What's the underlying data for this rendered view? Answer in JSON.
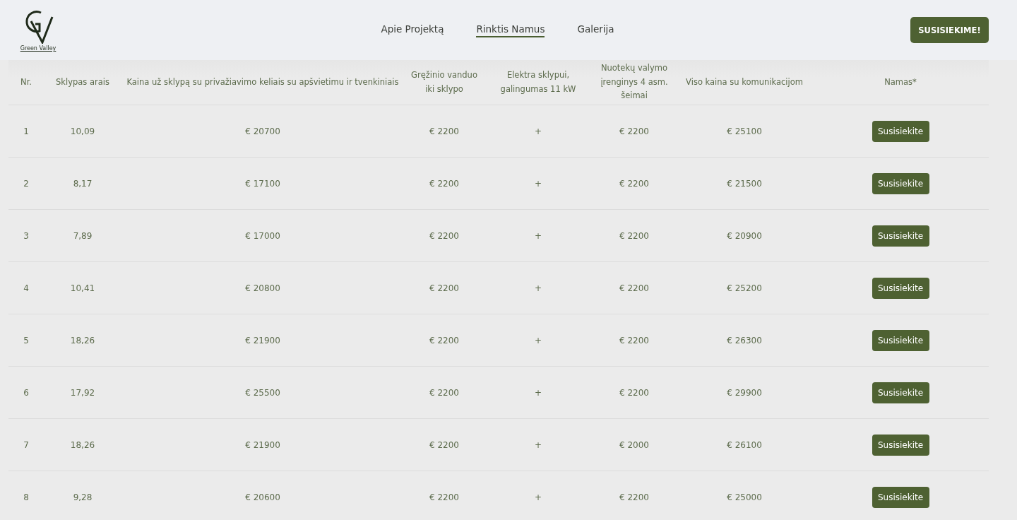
{
  "logo": {
    "name": "Green Valley"
  },
  "nav": [
    {
      "label": "Apie Projektą",
      "selected": false
    },
    {
      "label": "Rinktis Namus",
      "selected": true
    },
    {
      "label": "Galerija",
      "selected": false
    }
  ],
  "cta_button": "SUSISIEKIME!",
  "table": {
    "columns": [
      "Nr.",
      "Sklypas arais",
      "Kaina už sklypą su privažiavimo keliais su apšvietimu ir tvenkiniais",
      "Gręžinio vanduo iki sklypo",
      "Elektra sklypui, galingumas 11 kW",
      "Nuotekų valymo įrenginys 4 asm. šeimai",
      "Viso kaina su komunikacijom",
      "Namas*"
    ],
    "rows": [
      [
        "1",
        "10,09",
        "€ 20700",
        "€ 2200",
        "+",
        "€ 2200",
        "€ 25100",
        "Susisiekite"
      ],
      [
        "2",
        "8,17",
        "€ 17100",
        "€ 2200",
        "+",
        "€ 2200",
        "€ 21500",
        "Susisiekite"
      ],
      [
        "3",
        "7,89",
        "€ 17000",
        "€ 2200",
        "+",
        "€ 2200",
        "€ 20900",
        "Susisiekite"
      ],
      [
        "4",
        "10,41",
        "€ 20800",
        "€ 2200",
        "+",
        "€ 2200",
        "€ 25200",
        "Susisiekite"
      ],
      [
        "5",
        "18,26",
        "€ 21900",
        "€ 2200",
        "+",
        "€ 2200",
        "€ 26300",
        "Susisiekite"
      ],
      [
        "6",
        "17,92",
        "€ 25500",
        "€ 2200",
        "+",
        "€ 2200",
        "€ 29900",
        "Susisiekite"
      ],
      [
        "7",
        "18,26",
        "€ 21900",
        "€ 2200",
        "+",
        "€ 2000",
        "€ 26100",
        "Susisiekite"
      ],
      [
        "8",
        "9,28",
        "€ 20600",
        "€ 2200",
        "+",
        "€ 2200",
        "€ 25000",
        "Susisiekite"
      ]
    ]
  }
}
